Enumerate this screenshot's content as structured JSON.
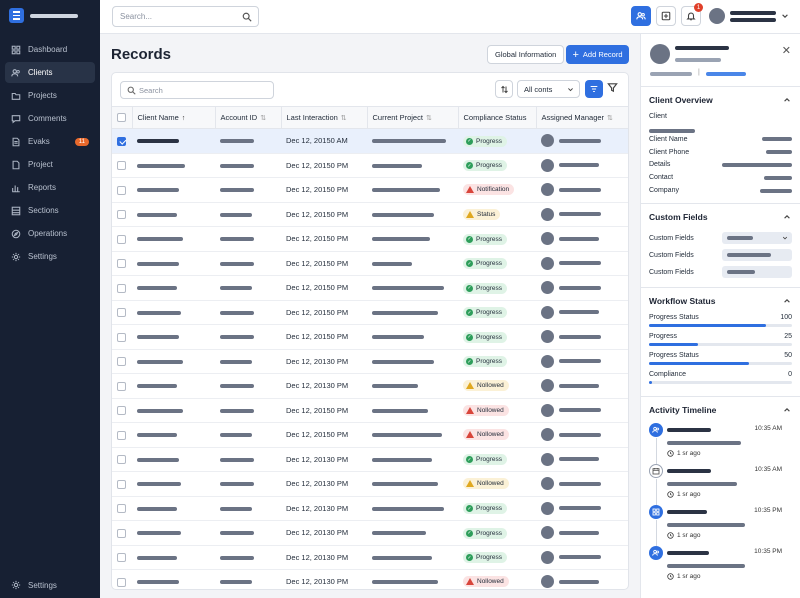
{
  "sidebar": {
    "items": [
      {
        "label": "Dashboard",
        "icon": "grid-icon",
        "active": false
      },
      {
        "label": "Clients",
        "icon": "users-icon",
        "active": true
      },
      {
        "label": "Projects",
        "icon": "folder-icon",
        "active": false
      },
      {
        "label": "Comments",
        "icon": "comment-icon",
        "active": false
      },
      {
        "label": "Evaks",
        "icon": "document-icon",
        "active": false,
        "badge": "11"
      },
      {
        "label": "Project",
        "icon": "file-icon",
        "active": false
      },
      {
        "label": "Reports",
        "icon": "bar-chart-icon",
        "active": false
      },
      {
        "label": "Sections",
        "icon": "sections-icon",
        "active": false
      },
      {
        "label": "Operations",
        "icon": "compass-icon",
        "active": false
      },
      {
        "label": "Settings",
        "icon": "gear-icon",
        "active": false
      }
    ],
    "footer_label": "Settings"
  },
  "topbar": {
    "search_placeholder": "Search...",
    "notification_count": "1"
  },
  "page": {
    "title": "Records",
    "global_info_label": "Global Information",
    "add_record_label": "Add Record"
  },
  "table_toolbar": {
    "search_placeholder": "Search",
    "filter_select": "All conts"
  },
  "table": {
    "columns": [
      "Client Name",
      "Account ID",
      "Last Interaction",
      "Current Project",
      "Compliance Status",
      "Assigned Manager"
    ],
    "rows": [
      {
        "checked": true,
        "interaction": "Dec 12, 20150 AM",
        "status": "Progress",
        "tone": "green"
      },
      {
        "checked": false,
        "interaction": "Dec 12, 20150 PM",
        "status": "Progress",
        "tone": "green"
      },
      {
        "checked": false,
        "interaction": "Dec 12, 20150 PM",
        "status": "Notification",
        "tone": "red"
      },
      {
        "checked": false,
        "interaction": "Dec 12, 20150 PM",
        "status": "Status",
        "tone": "yellow"
      },
      {
        "checked": false,
        "interaction": "Dec 12, 20150 PM",
        "status": "Progress",
        "tone": "green"
      },
      {
        "checked": false,
        "interaction": "Dec 12, 20150 PM",
        "status": "Progress",
        "tone": "green"
      },
      {
        "checked": false,
        "interaction": "Dec 12, 20150 PM",
        "status": "Progress",
        "tone": "green"
      },
      {
        "checked": false,
        "interaction": "Dec 12, 20150 PM",
        "status": "Progress",
        "tone": "green"
      },
      {
        "checked": false,
        "interaction": "Dec 12, 20150 PM",
        "status": "Progress",
        "tone": "green"
      },
      {
        "checked": false,
        "interaction": "Dec 12, 20130 PM",
        "status": "Progress",
        "tone": "green"
      },
      {
        "checked": false,
        "interaction": "Dec 12, 20130 PM",
        "status": "Nollowed",
        "tone": "yellow"
      },
      {
        "checked": false,
        "interaction": "Dec 12, 20150 PM",
        "status": "Nollowed",
        "tone": "red"
      },
      {
        "checked": false,
        "interaction": "Dec 12, 20150 PM",
        "status": "Nollowed",
        "tone": "red"
      },
      {
        "checked": false,
        "interaction": "Dec 12, 20130 PM",
        "status": "Progress",
        "tone": "green"
      },
      {
        "checked": false,
        "interaction": "Dec 12, 20130 PM",
        "status": "Nollowed",
        "tone": "yellow"
      },
      {
        "checked": false,
        "interaction": "Dec 12, 20130 PM",
        "status": "Progress",
        "tone": "green"
      },
      {
        "checked": false,
        "interaction": "Dec 12, 20130 PM",
        "status": "Progress",
        "tone": "green"
      },
      {
        "checked": false,
        "interaction": "Dec 12, 20130 PM",
        "status": "Progress",
        "tone": "green"
      },
      {
        "checked": false,
        "interaction": "Dec 12, 20130 PM",
        "status": "Nollowed",
        "tone": "red"
      }
    ]
  },
  "panel": {
    "client_overview": {
      "title": "Client Overview",
      "fields": [
        "Client",
        "Client Name",
        "Client Phone",
        "Details",
        "Contact",
        "Company"
      ]
    },
    "custom_fields": {
      "title": "Custom Fields",
      "labels": [
        "Custom Fields",
        "Custom Fields",
        "Custom Fields"
      ]
    },
    "workflow": {
      "title": "Workflow Status",
      "items": [
        {
          "label": "Progress Status",
          "value": "100",
          "fill": 0.82
        },
        {
          "label": "Progress",
          "value": "25",
          "fill": 0.34
        },
        {
          "label": "Progress Status",
          "value": "50",
          "fill": 0.7
        },
        {
          "label": "Compliance",
          "value": "0",
          "fill": 0.02
        }
      ]
    },
    "activity": {
      "title": "Activity Timeline",
      "items": [
        {
          "time": "10:35 AM",
          "ago": "1 sr ago",
          "icon": "users-icon",
          "style": "blue"
        },
        {
          "time": "10:35 AM",
          "ago": "1 sr ago",
          "icon": "calendar-icon",
          "style": "grey"
        },
        {
          "time": "10:35 PM",
          "ago": "1 sr ago",
          "icon": "grid-icon",
          "style": "blue"
        },
        {
          "time": "10:35 PM",
          "ago": "1 sr ago",
          "icon": "users-icon",
          "style": "blue"
        }
      ]
    }
  },
  "colors": {
    "accent": "#2f6fe0",
    "sidebar_bg": "#172033",
    "success": "#2e9e5b",
    "danger": "#d8453b",
    "warning": "#e0a820"
  }
}
